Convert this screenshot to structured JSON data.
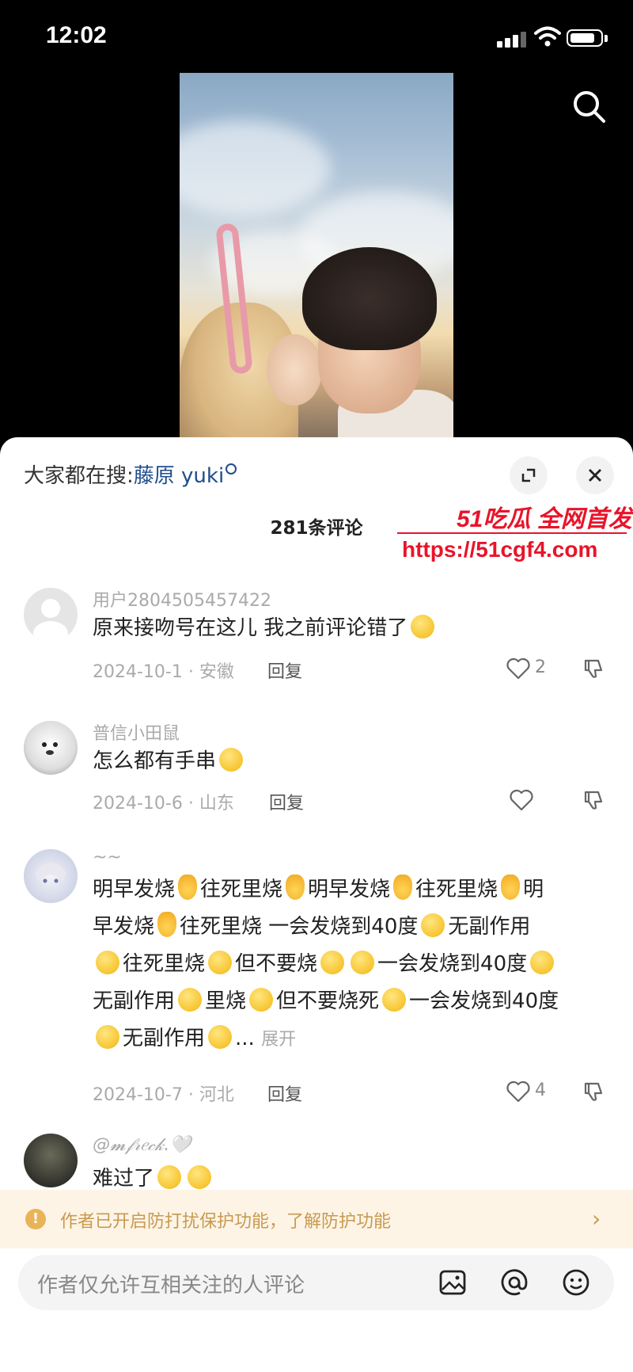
{
  "status_bar": {
    "time": "12:02"
  },
  "sheet": {
    "suggest_prefix": "大家都在搜:",
    "suggest_keyword": "藤原 yuki",
    "comment_count": "281条评论"
  },
  "comments": [
    {
      "user": "用户2804505457422",
      "text": "原来接吻号在这儿 我之前评论错了",
      "date_location": "2024-10-1 · 安徽",
      "reply": "回复",
      "likes": "2"
    },
    {
      "user": "普信小田鼠",
      "text": "怎么都有手串",
      "date_location": "2024-10-6 · 山东",
      "reply": "回复",
      "likes": ""
    },
    {
      "user": "~~",
      "lines": [
        [
          "明早发烧",
          "往死里烧",
          "明早发烧",
          "往死里烧",
          "明"
        ],
        [
          "早发烧",
          "往死里烧  一会发烧到40度",
          "无副作用"
        ],
        [
          "",
          "往死里烧",
          "但不要烧",
          "",
          "一会发烧到40度",
          ""
        ],
        [
          "无副作用",
          "里烧",
          "但不要烧死",
          "一会发烧到40度"
        ],
        [
          "",
          "无副作用",
          "..."
        ]
      ],
      "expand": "展开",
      "date_location": "2024-10-7 · 河北",
      "reply": "回复",
      "likes": "4"
    },
    {
      "user": "@𝓶𝒻𝓇𝑒𝒸𝓀.🤍",
      "text": "难过了",
      "date_location": "",
      "reply": "",
      "likes": ""
    }
  ],
  "notice": {
    "text": "作者已开启防打扰保护功能，了解防护功能"
  },
  "input": {
    "placeholder": "作者仅允许互相关注的人评论"
  },
  "watermark": {
    "brand": "51吃瓜 全网首发",
    "url": "https://51cgf4.com"
  },
  "colors": {
    "keyword": "#1e4d8c",
    "notice_text": "#c89a50",
    "notice_bg": "#fdf4e6",
    "watermark": "#e8142a"
  },
  "icons": [
    "signal-icon",
    "wifi-icon",
    "battery-icon",
    "search-icon",
    "expand-icon",
    "close-icon",
    "heart-icon",
    "dislike-icon",
    "warning-icon",
    "chevron-right-icon",
    "image-icon",
    "at-icon",
    "emoji-icon"
  ]
}
